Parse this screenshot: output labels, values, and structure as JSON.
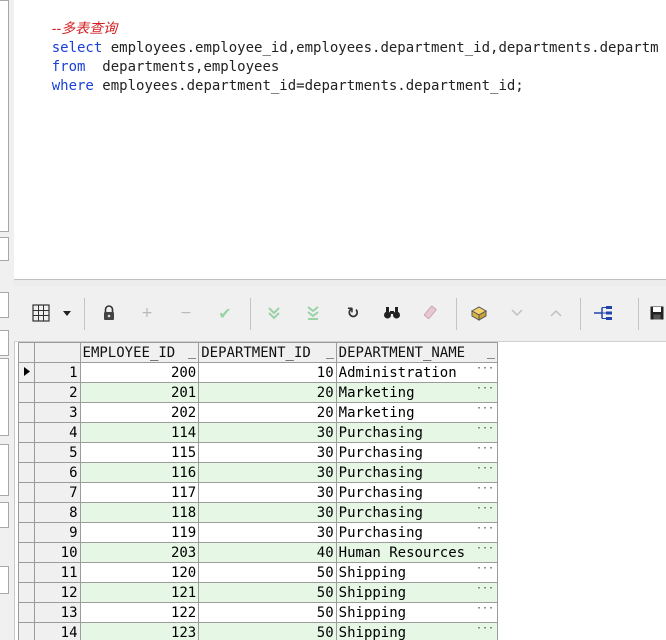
{
  "editor": {
    "comment": "--多表查询",
    "lines": [
      {
        "keyword": "select",
        "rest": " employees.employee_id,employees.department_id,departments.departm"
      },
      {
        "keyword": "from",
        "rest": "  departments,employees"
      },
      {
        "keyword": "where",
        "rest": " employees.department_id=departments.department_id;"
      }
    ]
  },
  "toolbar": {
    "icons": [
      "grid-icon",
      "dropdown-arrow-icon",
      "lock-icon",
      "add-icon",
      "remove-icon",
      "post-check-icon",
      "next-record-icon",
      "last-record-icon",
      "refresh-icon",
      "find-icon",
      "clear-icon",
      "export-icon",
      "move-down-icon",
      "move-up-icon",
      "tree-icon",
      "save-icon"
    ]
  },
  "grid": {
    "columns": [
      "EMPLOYEE_ID",
      "DEPARTMENT_ID",
      "DEPARTMENT_NAME"
    ],
    "rows": [
      {
        "n": "1",
        "employee_id": "200",
        "department_id": "10",
        "department_name": "Administration"
      },
      {
        "n": "2",
        "employee_id": "201",
        "department_id": "20",
        "department_name": "Marketing"
      },
      {
        "n": "3",
        "employee_id": "202",
        "department_id": "20",
        "department_name": "Marketing"
      },
      {
        "n": "4",
        "employee_id": "114",
        "department_id": "30",
        "department_name": "Purchasing"
      },
      {
        "n": "5",
        "employee_id": "115",
        "department_id": "30",
        "department_name": "Purchasing"
      },
      {
        "n": "6",
        "employee_id": "116",
        "department_id": "30",
        "department_name": "Purchasing"
      },
      {
        "n": "7",
        "employee_id": "117",
        "department_id": "30",
        "department_name": "Purchasing"
      },
      {
        "n": "8",
        "employee_id": "118",
        "department_id": "30",
        "department_name": "Purchasing"
      },
      {
        "n": "9",
        "employee_id": "119",
        "department_id": "30",
        "department_name": "Purchasing"
      },
      {
        "n": "10",
        "employee_id": "203",
        "department_id": "40",
        "department_name": "Human Resources"
      },
      {
        "n": "11",
        "employee_id": "120",
        "department_id": "50",
        "department_name": "Shipping"
      },
      {
        "n": "12",
        "employee_id": "121",
        "department_id": "50",
        "department_name": "Shipping"
      },
      {
        "n": "13",
        "employee_id": "122",
        "department_id": "50",
        "department_name": "Shipping"
      },
      {
        "n": "14",
        "employee_id": "123",
        "department_id": "50",
        "department_name": "Shipping"
      }
    ]
  }
}
